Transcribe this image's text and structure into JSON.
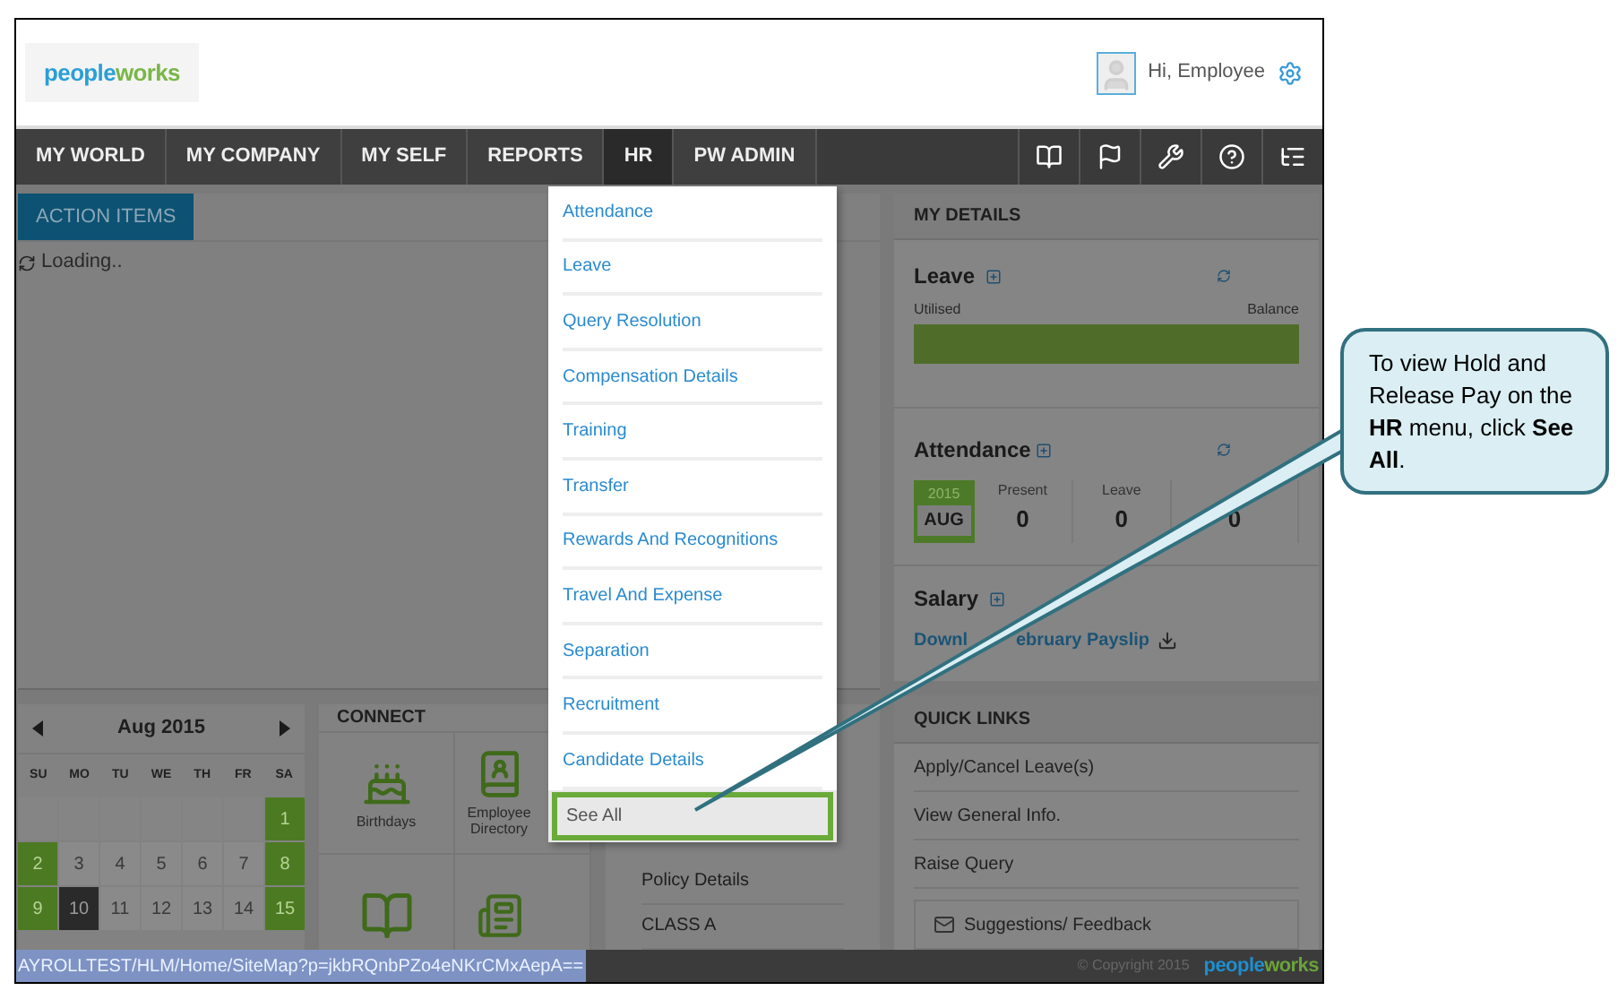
{
  "header": {
    "logo": [
      {
        "text": "people",
        "color": "#2a9fd6"
      },
      {
        "text": "works",
        "color": "#7ab648"
      }
    ],
    "greeting": "Hi, Employee"
  },
  "nav": {
    "items": [
      {
        "label": "MY WORLD",
        "selected": false
      },
      {
        "label": "MY COMPANY",
        "selected": false
      },
      {
        "label": "MY SELF",
        "selected": false
      },
      {
        "label": "REPORTS",
        "selected": false
      },
      {
        "label": "HR",
        "selected": true
      },
      {
        "label": "PW ADMIN",
        "selected": false
      }
    ]
  },
  "action_items": {
    "tab": "ACTION ITEMS",
    "status": "Loading.."
  },
  "hr_menu": {
    "items": [
      {
        "label": "Attendance",
        "highlighted": false
      },
      {
        "label": "Leave",
        "highlighted": false
      },
      {
        "label": "Query Resolution",
        "highlighted": false
      },
      {
        "label": "Compensation Details",
        "highlighted": false
      },
      {
        "label": "Training",
        "highlighted": false
      },
      {
        "label": "Transfer",
        "highlighted": false
      },
      {
        "label": "Rewards And Recognitions",
        "highlighted": false
      },
      {
        "label": "Travel And Expense",
        "highlighted": false
      },
      {
        "label": "Separation",
        "highlighted": false
      },
      {
        "label": "Recruitment",
        "highlighted": false
      },
      {
        "label": "Candidate Details",
        "highlighted": false
      },
      {
        "label": "See All",
        "highlighted": true
      }
    ]
  },
  "calendar": {
    "month": "Aug 2015",
    "weekdays": [
      "SU",
      "MO",
      "TU",
      "WE",
      "TH",
      "FR",
      "SA"
    ],
    "weeks": [
      [
        {
          "kind": "empty"
        },
        {
          "kind": "empty"
        },
        {
          "kind": "empty"
        },
        {
          "kind": "empty"
        },
        {
          "kind": "empty"
        },
        {
          "kind": "empty"
        },
        {
          "kind": "weekend",
          "day": "1"
        }
      ],
      [
        {
          "kind": "weekend",
          "day": "2"
        },
        {
          "kind": "day",
          "day": "3"
        },
        {
          "kind": "day",
          "day": "4"
        },
        {
          "kind": "day",
          "day": "5"
        },
        {
          "kind": "day",
          "day": "6"
        },
        {
          "kind": "day",
          "day": "7"
        },
        {
          "kind": "weekend",
          "day": "8"
        }
      ],
      [
        {
          "kind": "weekend",
          "day": "9"
        },
        {
          "kind": "today",
          "day": "10"
        },
        {
          "kind": "day",
          "day": "11"
        },
        {
          "kind": "day",
          "day": "12"
        },
        {
          "kind": "day",
          "day": "13"
        },
        {
          "kind": "day",
          "day": "14"
        },
        {
          "kind": "weekend",
          "day": "15"
        }
      ]
    ]
  },
  "connect": {
    "title": "CONNECT",
    "tiles": [
      {
        "kind": "birthdays",
        "label": "Birthdays"
      },
      {
        "kind": "directory",
        "label": "Employee Directory"
      },
      {
        "kind": "book"
      },
      {
        "kind": "news"
      }
    ]
  },
  "policies": {
    "items": [
      "Policy Details",
      "CLASS A"
    ]
  },
  "my_details": {
    "title": "MY DETAILS",
    "leave": {
      "title": "Leave",
      "utilised": "Utilised",
      "balance": "Balance",
      "level": 1
    },
    "attendance": {
      "title": "Attendance",
      "year": "2015",
      "month": "AUG",
      "stats": [
        {
          "label": "Present",
          "value": "0"
        },
        {
          "label": "Leave",
          "value": "0"
        },
        {
          "value": "0"
        }
      ]
    },
    "salary": {
      "title": "Salary",
      "link": [
        "Downl",
        "ebruary Payslip"
      ]
    }
  },
  "quick_links": {
    "title": "QUICK LINKS",
    "items": [
      "Apply/Cancel Leave(s)",
      "View General Info.",
      "Raise Query"
    ],
    "feedback": "Suggestions/ Feedback"
  },
  "status_bar": {
    "url": "AYROLLTEST/HLM/Home/SiteMap?p=jkbRQnbPZo4eNKrCMxAepA==",
    "copyright": "© Copyright 2015",
    "logo": [
      {
        "text": "people",
        "color": "#1d8fd0"
      },
      {
        "text": "works",
        "color": "#6aa33a"
      }
    ]
  },
  "callout": {
    "text": "To view Hold and Release Pay  on the **HR** menu, click **See All**."
  }
}
